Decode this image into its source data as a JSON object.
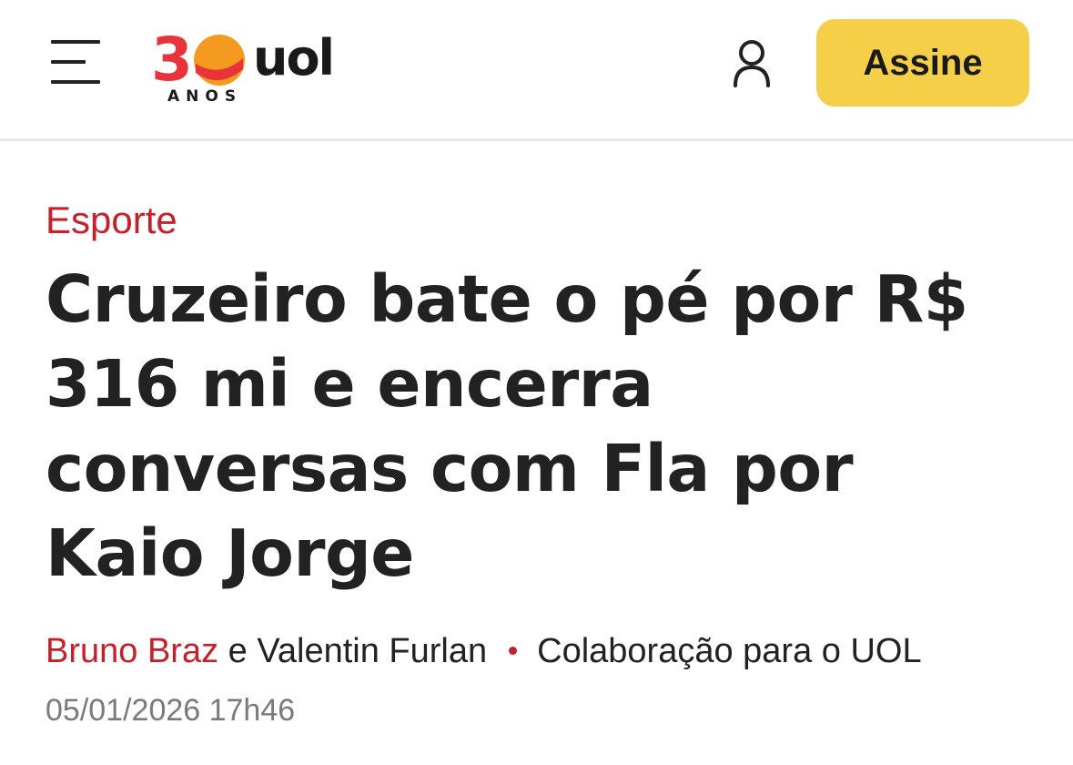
{
  "header": {
    "logo": {
      "number": "30",
      "brand": "uol",
      "tagline": "ANOS"
    },
    "subscribe_label": "Assine",
    "colors": {
      "subscribe_bg": "#f5cf48",
      "logo_red": "#e8333a",
      "logo_orange": "#f39a1f"
    },
    "icons": [
      "menu-icon",
      "user-icon"
    ]
  },
  "article": {
    "category": "Esporte",
    "headline": "Cruzeiro bate o pé por R$ 316 mi e encerra conversas com Fla por Kaio Jorge",
    "byline": {
      "author1": "Bruno Braz",
      "conjunction": " e ",
      "author2": "Valentin Furlan",
      "source": "Colaboração para o UOL"
    },
    "date": "05/01/2026 17h46",
    "colors": {
      "accent": "#c4212c",
      "date": "#7a7a7a"
    }
  }
}
